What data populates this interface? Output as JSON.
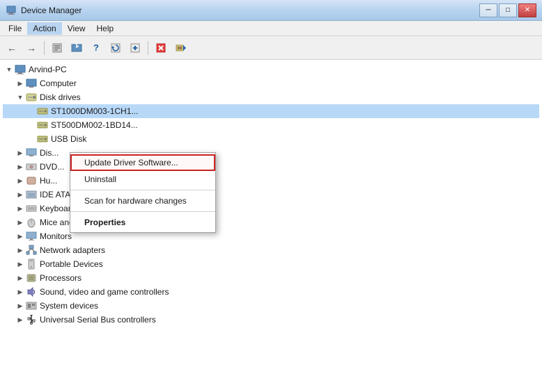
{
  "window": {
    "title": "Device Manager",
    "minimize_label": "─",
    "restore_label": "□",
    "close_label": "✕"
  },
  "menubar": {
    "items": [
      "File",
      "Action",
      "View",
      "Help"
    ]
  },
  "toolbar": {
    "buttons": [
      "←",
      "→",
      "📋",
      "📋",
      "?",
      "📋",
      "🔄",
      "📋",
      "❌",
      "🔧"
    ]
  },
  "tree": {
    "root": "Arvind-PC",
    "items": [
      {
        "id": "arvind",
        "label": "Arvind-PC",
        "indent": 0,
        "expanded": true,
        "type": "computer"
      },
      {
        "id": "computer",
        "label": "Computer",
        "indent": 1,
        "expanded": false,
        "type": "device"
      },
      {
        "id": "disk-drives",
        "label": "Disk drives",
        "indent": 1,
        "expanded": true,
        "type": "device"
      },
      {
        "id": "disk1",
        "label": "ST1000DM003-1CH1...",
        "indent": 2,
        "expanded": false,
        "type": "disk",
        "selected": true
      },
      {
        "id": "disk2",
        "label": "",
        "indent": 2,
        "expanded": false,
        "type": "disk"
      },
      {
        "id": "disk3",
        "label": "",
        "indent": 2,
        "expanded": false,
        "type": "disk"
      },
      {
        "id": "dis",
        "label": "Dis...",
        "indent": 1,
        "expanded": false,
        "type": "device"
      },
      {
        "id": "dvd",
        "label": "DVD...",
        "indent": 1,
        "expanded": false,
        "type": "device"
      },
      {
        "id": "hu",
        "label": "Hu...",
        "indent": 1,
        "expanded": false,
        "type": "device"
      },
      {
        "id": "ide",
        "label": "IDE ATA/ATAPI controllers",
        "indent": 1,
        "expanded": false,
        "type": "device"
      },
      {
        "id": "keyboards",
        "label": "Keyboards",
        "indent": 1,
        "expanded": false,
        "type": "device"
      },
      {
        "id": "mice",
        "label": "Mice and other pointing devices",
        "indent": 1,
        "expanded": false,
        "type": "device"
      },
      {
        "id": "monitors",
        "label": "Monitors",
        "indent": 1,
        "expanded": false,
        "type": "device"
      },
      {
        "id": "network",
        "label": "Network adapters",
        "indent": 1,
        "expanded": false,
        "type": "device"
      },
      {
        "id": "portable",
        "label": "Portable Devices",
        "indent": 1,
        "expanded": false,
        "type": "device"
      },
      {
        "id": "processors",
        "label": "Processors",
        "indent": 1,
        "expanded": false,
        "type": "device"
      },
      {
        "id": "sound",
        "label": "Sound, video and game controllers",
        "indent": 1,
        "expanded": false,
        "type": "device"
      },
      {
        "id": "system",
        "label": "System devices",
        "indent": 1,
        "expanded": false,
        "type": "device"
      },
      {
        "id": "usb",
        "label": "Universal Serial Bus controllers",
        "indent": 1,
        "expanded": false,
        "type": "device"
      }
    ]
  },
  "context_menu": {
    "items": [
      {
        "id": "update",
        "label": "Update Driver Software...",
        "highlighted": true
      },
      {
        "id": "uninstall",
        "label": "Uninstall"
      },
      {
        "id": "scan",
        "label": "Scan for hardware changes"
      },
      {
        "id": "properties",
        "label": "Properties",
        "bold": true
      }
    ]
  }
}
